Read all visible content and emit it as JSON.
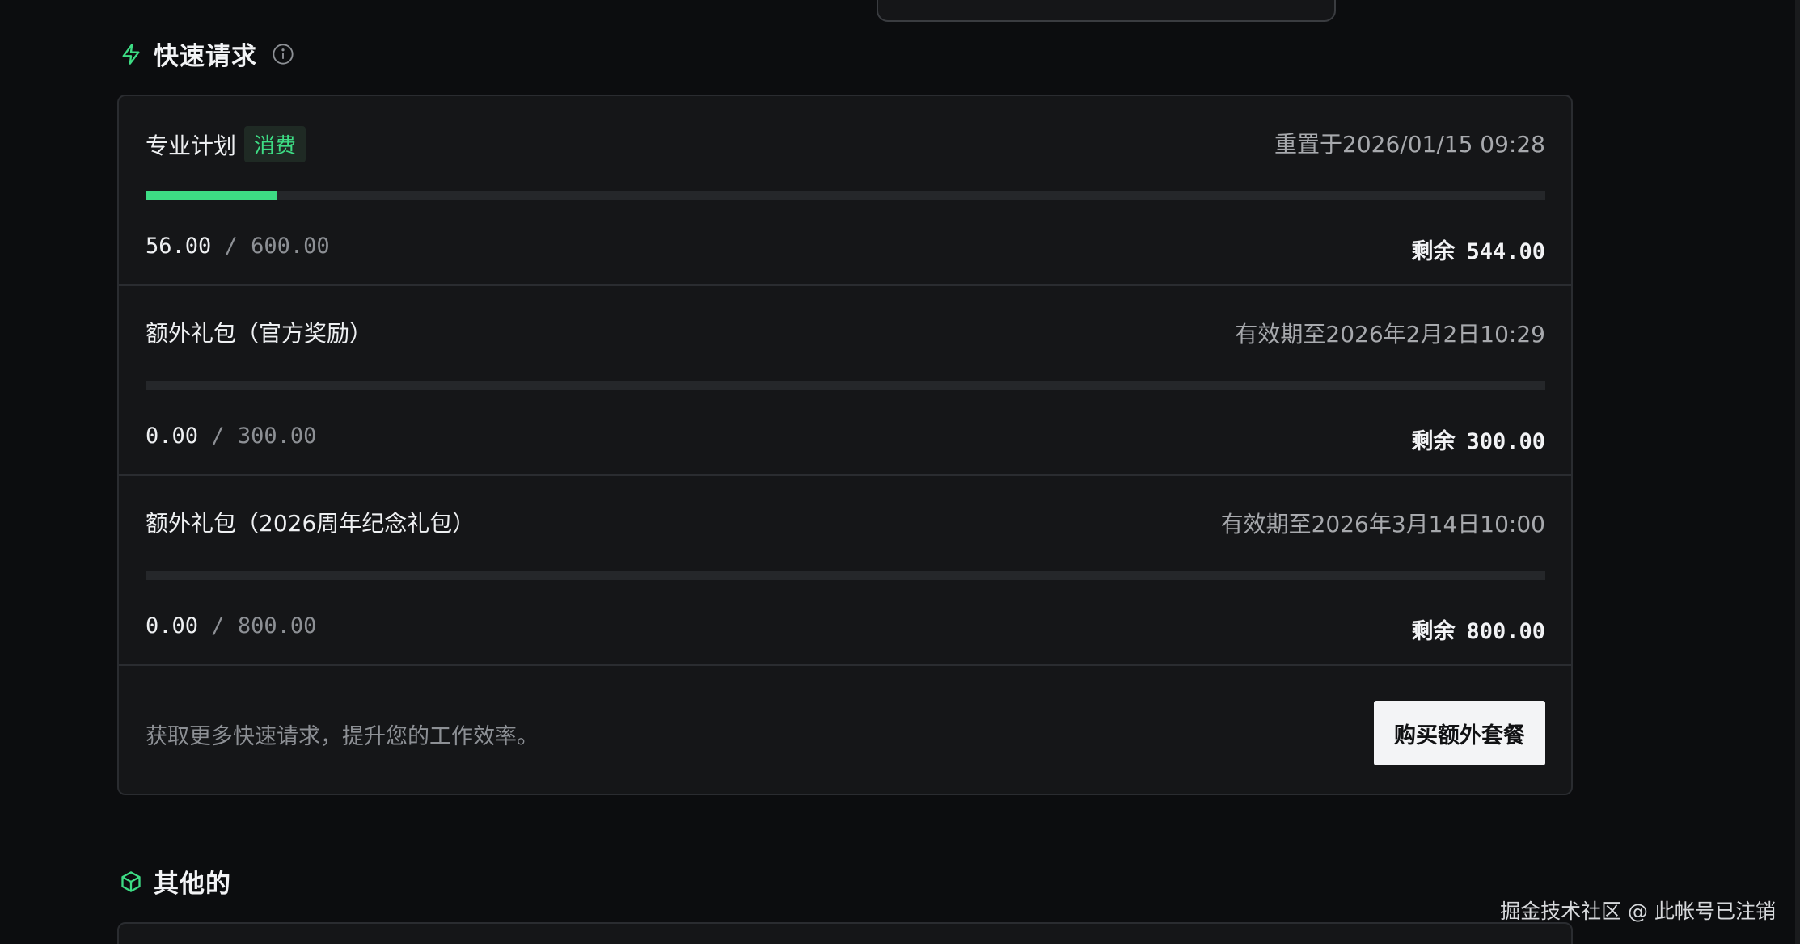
{
  "quick_requests": {
    "title": "快速请求",
    "icons": {
      "heading": "lightning-icon",
      "info": "info-icon"
    },
    "quotas": [
      {
        "title": "专业计划",
        "badge": "消费",
        "date_text": "重置于2026/01/15 09:28",
        "used": "56.00",
        "separator": "/",
        "total": "600.00",
        "progress_fraction": 0.0933,
        "remaining_label": "剩余",
        "remaining": "544.00"
      },
      {
        "title": "额外礼包（官方奖励）",
        "date_text": "有效期至2026年2月2日10:29",
        "used": "0.00",
        "separator": "/",
        "total": "300.00",
        "progress_fraction": 0,
        "remaining_label": "剩余",
        "remaining": "300.00"
      },
      {
        "title": "额外礼包（2026周年纪念礼包）",
        "date_text": "有效期至2026年3月14日10:00",
        "used": "0.00",
        "separator": "/",
        "total": "800.00",
        "progress_fraction": 0,
        "remaining_label": "剩余",
        "remaining": "800.00"
      }
    ],
    "footer_text": "获取更多快速请求，提升您的工作效率。",
    "buy_button_label": "购买额外套餐"
  },
  "other": {
    "title": "其他的",
    "icon": "cube-icon"
  },
  "watermark": "掘金技术社区 @ 此帐号已注销",
  "colors": {
    "accent": "#3ddc84",
    "background": "#0c0d0f",
    "card": "#151618"
  }
}
